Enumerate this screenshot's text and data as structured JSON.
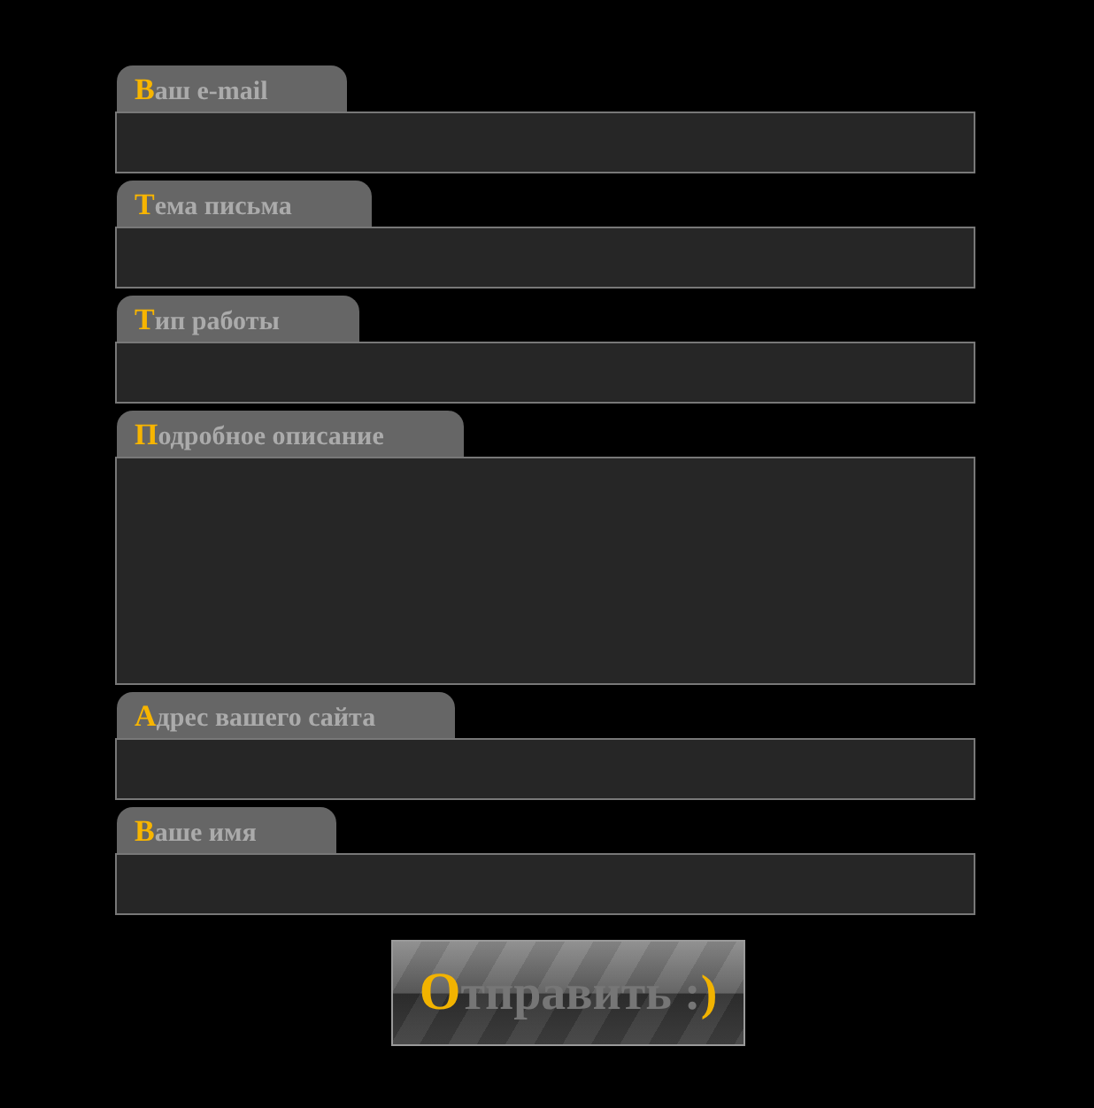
{
  "form": {
    "fields": [
      {
        "label": "Ваш e-mail",
        "kind": "input"
      },
      {
        "label": "Тема письма",
        "kind": "input"
      },
      {
        "label": "Тип работы",
        "kind": "input"
      },
      {
        "label": "Подробное описание",
        "kind": "textarea"
      },
      {
        "label": "Адрес вашего сайта",
        "kind": "input"
      },
      {
        "label": "Ваше имя",
        "kind": "input"
      }
    ],
    "submit_button": {
      "label": "Отправить :)"
    }
  }
}
